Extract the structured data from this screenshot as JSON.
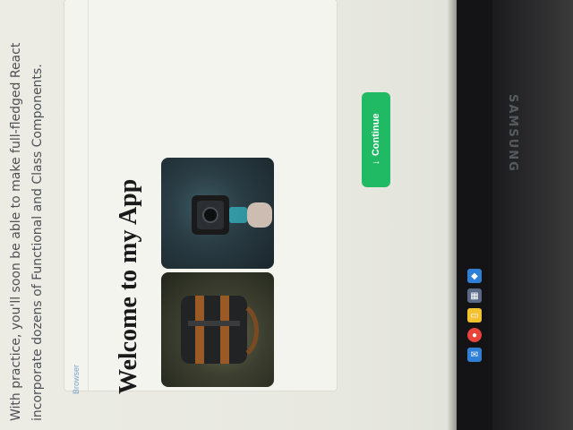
{
  "intro_text": "With practice, you'll soon be able to make full-fledged React\nincorporate dozens of Functional and Class Components.",
  "browser": {
    "label": "Browser"
  },
  "app": {
    "title": "Welcome to my App",
    "continue_label": "Continue",
    "continue_icon": "arrow-down-icon"
  },
  "products": [
    {
      "name": "camera-image",
      "icon": "action-camera"
    },
    {
      "name": "backpack-image",
      "icon": "leather-backpack"
    }
  ],
  "monitor": {
    "brand": "SAMSUNG"
  },
  "taskbar": {
    "icons": [
      "vscode-icon",
      "calculator-icon",
      "file-explorer-icon",
      "chrome-icon",
      "mail-icon"
    ],
    "colors": {
      "vscode": "#2f7fd6",
      "calculator": "#5a6a86",
      "explorer": "#f2c231",
      "chrome": "#e9443a",
      "mail": "#2f7fd6"
    }
  },
  "colors": {
    "continue_button": "#1fba63",
    "panel_background": "#f4f4ee",
    "title_text": "#1a1a1a"
  }
}
